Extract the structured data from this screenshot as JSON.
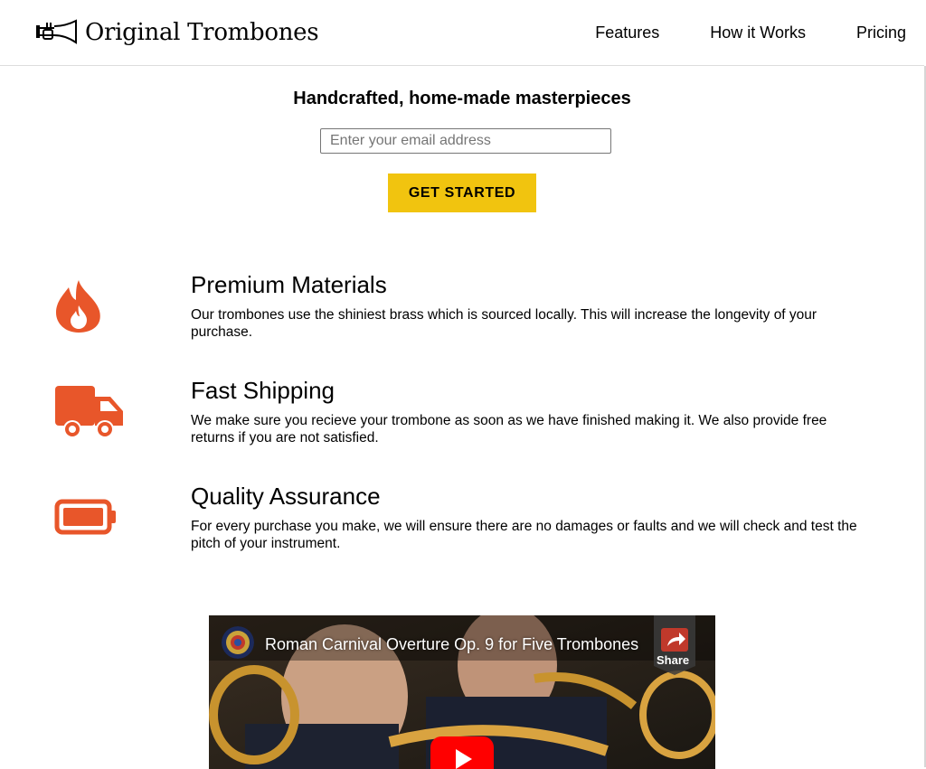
{
  "brand": {
    "name": "Original Trombones",
    "logo_icon": "trumpet-icon"
  },
  "nav": {
    "items": [
      {
        "label": "Features"
      },
      {
        "label": "How it Works"
      },
      {
        "label": "Pricing"
      }
    ]
  },
  "hero": {
    "title": "Handcrafted, home-made masterpieces",
    "email_placeholder": "Enter your email address",
    "cta_label": "GET STARTED"
  },
  "features": [
    {
      "icon": "fire-icon",
      "title": "Premium Materials",
      "description": "Our trombones use the shiniest brass which is sourced locally. This will increase the longevity of your purchase."
    },
    {
      "icon": "truck-icon",
      "title": "Fast Shipping",
      "description": "We make sure you recieve your trombone as soon as we have finished making it. We also provide free returns if you are not satisfied."
    },
    {
      "icon": "battery-icon",
      "title": "Quality Assurance",
      "description": "For every purchase you make, we will ensure there are no damages or faults and we will check and test the pitch of your instrument."
    }
  ],
  "video": {
    "title": "Roman Carnival Overture Op. 9 for Five Trombones",
    "share_label": "Share"
  },
  "colors": {
    "accent": "#f1c40f",
    "icon": "#e8562a"
  }
}
